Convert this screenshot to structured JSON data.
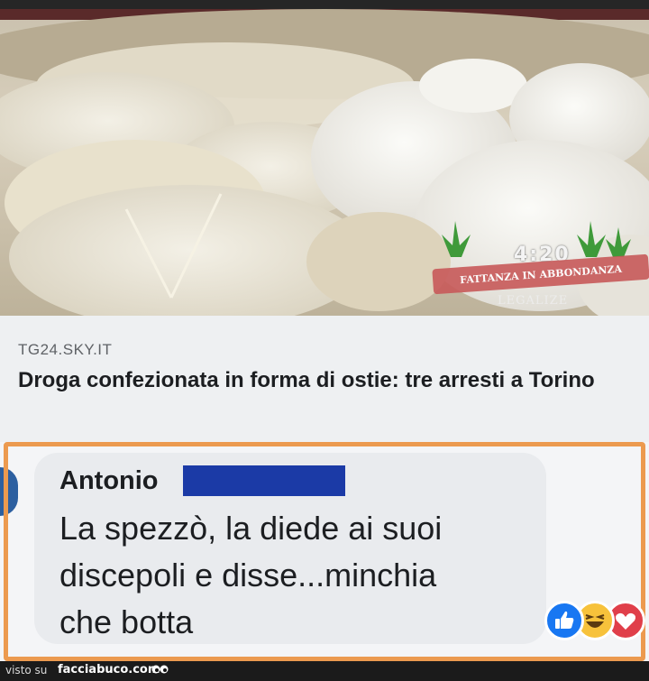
{
  "photo": {
    "alt": "communion wafers",
    "watermark": {
      "number": "4:20",
      "banner": "FATTANZA IN ABBONDANZA",
      "subtitle": "LEGALIZE"
    }
  },
  "article": {
    "source": "TG24.SKY.IT",
    "headline": "Droga confezionata in forma di ostie: tre arresti a Torino"
  },
  "comment": {
    "author": "Antonio",
    "lines": [
      "La spezzò, la diede ai suoi",
      "discepoli e disse...minchia",
      "che botta"
    ],
    "reactions": [
      "like-icon",
      "haha-icon",
      "love-icon"
    ]
  },
  "footer": {
    "visto": "visto su",
    "site": "facciabuco.com"
  },
  "colors": {
    "highlight": "#ec9a4f",
    "redaction": "#1b3aa6",
    "like": "#1877f2",
    "haha": "#f7c23b",
    "love": "#e03f4a"
  }
}
